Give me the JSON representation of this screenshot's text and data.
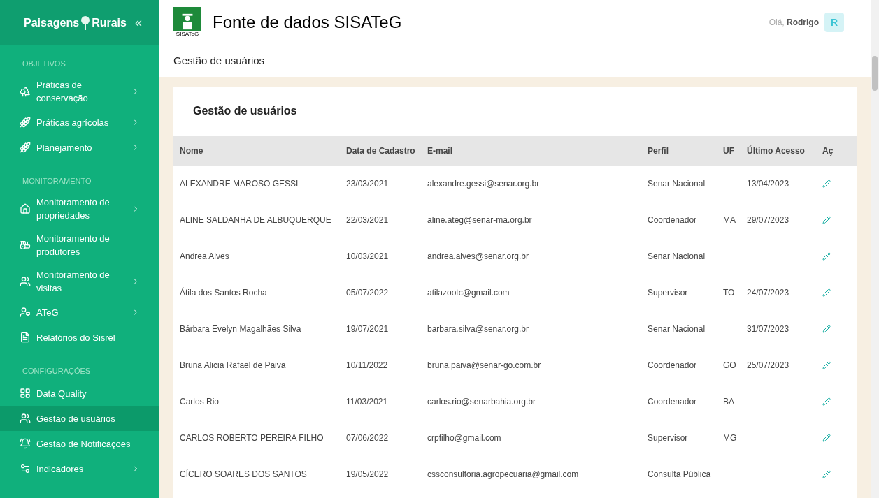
{
  "sidebar": {
    "brand": "Paisagens",
    "brand_2": "Rurais",
    "collapse": "«",
    "sections": [
      {
        "heading": "OBJETIVOS",
        "items": [
          {
            "label": "Práticas de conservação",
            "chevron": true,
            "selected": false
          },
          {
            "label": "Práticas agrícolas",
            "chevron": true,
            "selected": false
          },
          {
            "label": "Planejamento",
            "chevron": true,
            "selected": false
          }
        ]
      },
      {
        "heading": "MONITORAMENTO",
        "items": [
          {
            "label": "Monitoramento de propriedades",
            "chevron": true,
            "selected": false
          },
          {
            "label": "Monitoramento de produtores",
            "chevron": false,
            "selected": false
          },
          {
            "label": "Monitoramento de visitas",
            "chevron": true,
            "selected": false
          },
          {
            "label": "ATeG",
            "chevron": true,
            "selected": false
          },
          {
            "label": "Relatórios do Sisrel",
            "chevron": false,
            "selected": false
          }
        ]
      },
      {
        "heading": "CONFIGURAÇÕES",
        "items": [
          {
            "label": "Data Quality",
            "chevron": false,
            "selected": false
          },
          {
            "label": "Gestão de usuários",
            "chevron": false,
            "selected": true
          },
          {
            "label": "Gestão de Notificações",
            "chevron": false,
            "selected": false
          },
          {
            "label": "Indicadores",
            "chevron": true,
            "selected": false
          }
        ]
      }
    ]
  },
  "header": {
    "logo_caption": "SISATeG",
    "title": "Fonte de dados SISATeG",
    "greeting": "Olá,",
    "user": "Rodrigo",
    "avatar": "R"
  },
  "breadcrumb": "Gestão de usuários",
  "card": {
    "title": "Gestão de usuários",
    "columns": [
      "Nome",
      "Data de Cadastro",
      "E-mail",
      "Perfil",
      "UF",
      "Último Acesso",
      "Aç"
    ],
    "rows": [
      {
        "nome": "ALEXANDRE MAROSO GESSI",
        "data": "23/03/2021",
        "email": "alexandre.gessi@senar.org.br",
        "perfil": "Senar Nacional",
        "ultimo_acesso": "13/04/2023"
      },
      {
        "nome": "ALINE SALDANHA DE ALBUQUERQUE",
        "data": "22/03/2021",
        "email": "aline.ateg@senar-ma.org.br",
        "perfil": "Coordenador",
        "uf": "MA",
        "ultimo_acesso": "29/07/2023"
      },
      {
        "nome": "Andrea Alves",
        "data": "10/03/2021",
        "email": "andrea.alves@senar.org.br",
        "perfil": "Senar Nacional"
      },
      {
        "nome": "Átila dos Santos Rocha",
        "data": "05/07/2022",
        "email": "atilazootc@gmail.com",
        "perfil": "Supervisor",
        "uf": "TO",
        "ultimo_acesso": "24/07/2023"
      },
      {
        "nome": "Bárbara Evelyn Magalhães Silva",
        "data": "19/07/2021",
        "email": "barbara.silva@senar.org.br",
        "perfil": "Senar Nacional",
        "ultimo_acesso": "31/07/2023"
      },
      {
        "nome": "Bruna Alicia Rafael de Paiva",
        "data": "10/11/2022",
        "email": "bruna.paiva@senar-go.com.br",
        "perfil": "Coordenador",
        "uf": "GO",
        "ultimo_acesso": "25/07/2023"
      },
      {
        "nome": "Carlos Rio",
        "data": "11/03/2021",
        "email": "carlos.rio@senarbahia.org.br",
        "perfil": "Coordenador",
        "uf": "BA"
      },
      {
        "nome": "CARLOS ROBERTO PEREIRA FILHO",
        "data": "07/06/2022",
        "email": "crpfilho@gmail.com",
        "perfil": "Supervisor",
        "uf": "MG"
      },
      {
        "nome": "CÍCERO SOARES DOS SANTOS",
        "data": "19/05/2022",
        "email": "cssconsultoria.agropecuaria@gmail.com",
        "perfil": "Consulta Pública"
      }
    ]
  }
}
